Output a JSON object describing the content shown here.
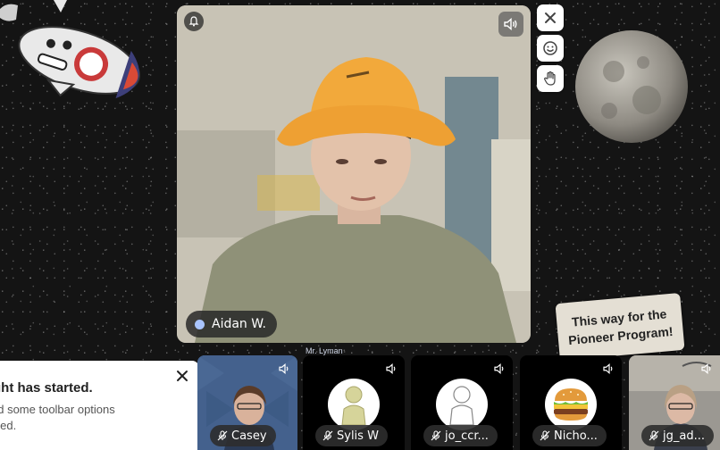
{
  "main_video": {
    "participant_name": "Aidan W."
  },
  "background": {
    "sign_line1": "This way for the",
    "sign_line2": "Pioneer Program!",
    "behind_label": "Mr. Lyman"
  },
  "side_controls": [
    "close-icon",
    "emoji-icon",
    "raise-hand-icon"
  ],
  "toast": {
    "title": "ght has started.",
    "body_line1": "nd some toolbar options",
    "body_line2": "bled."
  },
  "participants": [
    {
      "name": "Casey",
      "avatar": "camera"
    },
    {
      "name": "Sylis W",
      "avatar": "person-icon-yellow"
    },
    {
      "name": "jo_ccr...",
      "avatar": "person-icon-white"
    },
    {
      "name": "Nicho...",
      "avatar": "burger-icon"
    },
    {
      "name": "jg_ad...",
      "avatar": "camera"
    }
  ],
  "colors": {
    "status_dot": "#a9c4ff",
    "hat": "#f2a93b",
    "sylis_avatar": "#d6d49a"
  }
}
